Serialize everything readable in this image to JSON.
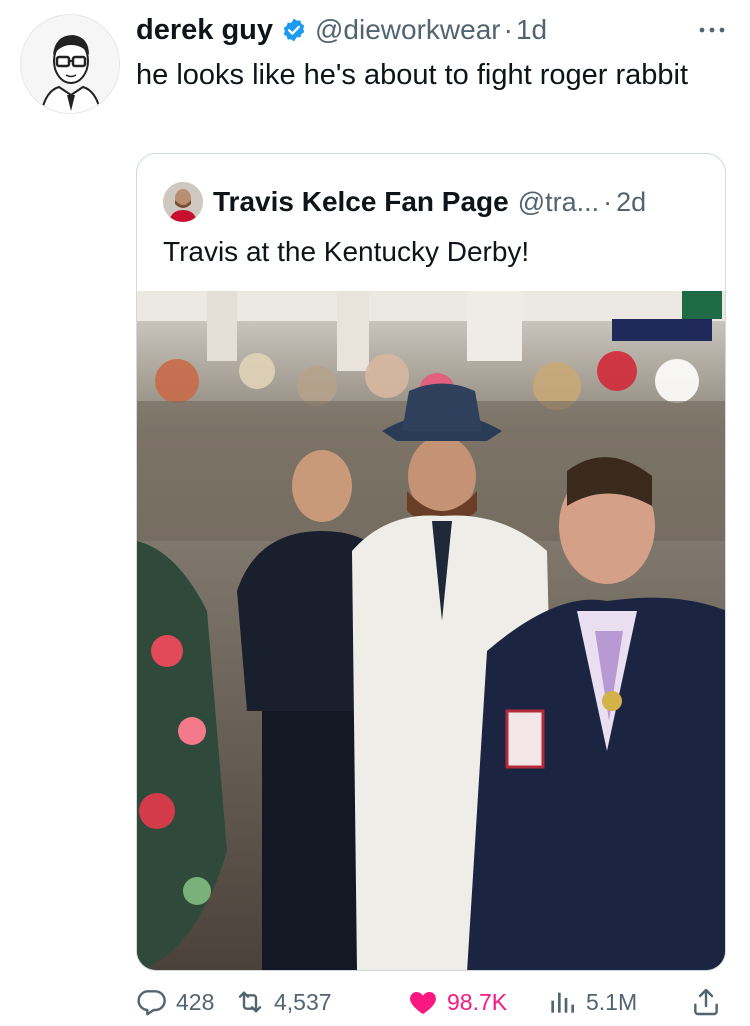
{
  "tweet": {
    "author_name": "derek guy",
    "handle": "@dieworkwear",
    "separator": "·",
    "time": "1d",
    "text": "he looks like he's about to fight roger rabbit"
  },
  "quoted_tweet": {
    "author_name": "Travis Kelce Fan Page",
    "handle": "@tra...",
    "separator": "·",
    "time": "2d",
    "text": "Travis at the Kentucky Derby!"
  },
  "actions": {
    "replies": "428",
    "retweets": "4,537",
    "likes": "98.7K",
    "views": "5.1M"
  },
  "colors": {
    "text": "#0f1419",
    "secondary": "#536471",
    "verified": "#1d9bf0",
    "like": "#f91880",
    "border": "#cfd9de"
  },
  "icons": [
    "verified-badge-icon",
    "more-options-icon",
    "reply-icon",
    "retweet-icon",
    "heart-icon",
    "views-icon",
    "share-icon"
  ]
}
